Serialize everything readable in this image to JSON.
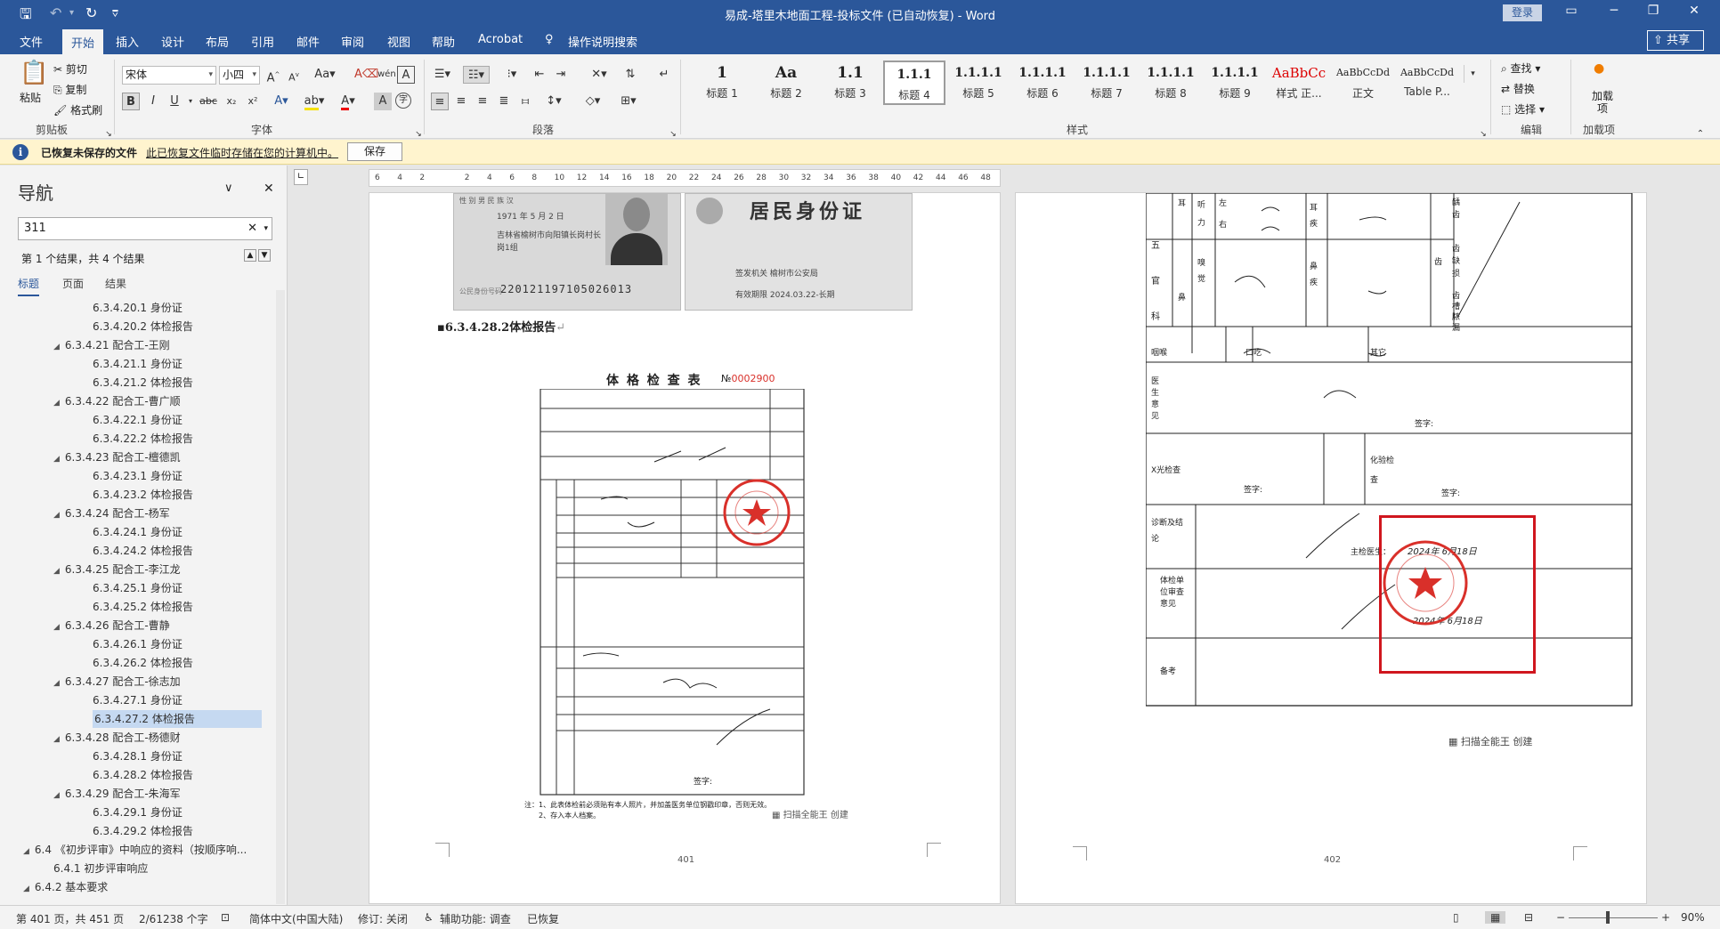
{
  "window": {
    "title": "易成-塔里木地面工程-投标文件 (已自动恢复)  -  Word",
    "login": "登录"
  },
  "tabs": [
    "文件",
    "开始",
    "插入",
    "设计",
    "布局",
    "引用",
    "邮件",
    "审阅",
    "视图",
    "帮助",
    "Acrobat",
    "操作说明搜索"
  ],
  "share": "共享",
  "ribbon": {
    "clipboard": {
      "paste": "粘贴",
      "cut": "剪切",
      "copy": "复制",
      "format_painter": "格式刷",
      "group": "剪贴板"
    },
    "font": {
      "name": "宋体",
      "size": "小四",
      "group": "字体"
    },
    "paragraph": {
      "group": "段落"
    },
    "styles": {
      "group": "样式",
      "items": [
        {
          "sample": "1",
          "name": "标题 1"
        },
        {
          "sample": "Aa",
          "name": "标题 2"
        },
        {
          "sample": "1.1",
          "name": "标题 3"
        },
        {
          "sample": "1.1.1",
          "name": "标题 4"
        },
        {
          "sample": "1.1.1.1",
          "name": "标题 5"
        },
        {
          "sample": "1.1.1.1",
          "name": "标题 6"
        },
        {
          "sample": "1.1.1.1",
          "name": "标题 7"
        },
        {
          "sample": "1.1.1.1",
          "name": "标题 8"
        },
        {
          "sample": "1.1.1.1",
          "name": "标题 9"
        },
        {
          "sample": "AaBbCc",
          "name": "样式 正..."
        },
        {
          "sample": "AaBbCcDd",
          "name": "正文"
        },
        {
          "sample": "AaBbCcDd",
          "name": "Table P..."
        }
      ]
    },
    "editing": {
      "find": "查找",
      "replace": "替换",
      "select": "选择",
      "group": "编辑"
    },
    "addins": {
      "label": "加载项",
      "group": "加载项"
    }
  },
  "infobar": {
    "title": "已恢复未保存的文件",
    "message": "此已恢复文件临时存储在您的计算机中。",
    "save": "保存"
  },
  "nav": {
    "title": "导航",
    "search": "311",
    "result_count": "第 1 个结果，共 4 个结果",
    "tabs": [
      "标题",
      "页面",
      "结果"
    ],
    "items": [
      {
        "text": "6.3.4.20.1 身份证",
        "level": 3
      },
      {
        "text": "6.3.4.20.2 体检报告",
        "level": 3
      },
      {
        "text": "6.3.4.21 配合工-王刚",
        "level": 2
      },
      {
        "text": "6.3.4.21.1 身份证",
        "level": 3
      },
      {
        "text": "6.3.4.21.2 体检报告",
        "level": 3
      },
      {
        "text": "6.3.4.22 配合工-曹广顺",
        "level": 2
      },
      {
        "text": "6.3.4.22.1 身份证",
        "level": 3
      },
      {
        "text": "6.3.4.22.2 体检报告",
        "level": 3
      },
      {
        "text": "6.3.4.23 配合工-檀德凯",
        "level": 2
      },
      {
        "text": "6.3.4.23.1 身份证",
        "level": 3
      },
      {
        "text": "6.3.4.23.2 体检报告",
        "level": 3
      },
      {
        "text": "6.3.4.24 配合工-杨军",
        "level": 2
      },
      {
        "text": "6.3.4.24.1 身份证",
        "level": 3
      },
      {
        "text": "6.3.4.24.2 体检报告",
        "level": 3
      },
      {
        "text": "6.3.4.25 配合工-李江龙",
        "level": 2
      },
      {
        "text": "6.3.4.25.1 身份证",
        "level": 3
      },
      {
        "text": "6.3.4.25.2 体检报告",
        "level": 3
      },
      {
        "text": "6.3.4.26 配合工-曹静",
        "level": 2
      },
      {
        "text": "6.3.4.26.1 身份证",
        "level": 3
      },
      {
        "text": "6.3.4.26.2 体检报告",
        "level": 3
      },
      {
        "text": "6.3.4.27 配合工-徐志加",
        "level": 2
      },
      {
        "text": "6.3.4.27.1 身份证",
        "level": 3
      },
      {
        "text": "6.3.4.27.2 体检报告",
        "level": 3,
        "selected": true
      },
      {
        "text": "6.3.4.28 配合工-杨德财",
        "level": 2
      },
      {
        "text": "6.3.4.28.1 身份证",
        "level": 3
      },
      {
        "text": "6.3.4.28.2 体检报告",
        "level": 3
      },
      {
        "text": "6.3.4.29 配合工-朱海军",
        "level": 2
      },
      {
        "text": "6.3.4.29.1 身份证",
        "level": 3
      },
      {
        "text": "6.3.4.29.2 体检报告",
        "level": 3
      },
      {
        "text": "6.4 《初步评审》中响应的资料（按顺序响...",
        "level": 0
      },
      {
        "text": "6.4.1 初步评审响应",
        "level": 1
      },
      {
        "text": "6.4.2 基本要求",
        "level": 0
      }
    ]
  },
  "ruler": [
    "6",
    "4",
    "2",
    "",
    "2",
    "4",
    "6",
    "8",
    "10",
    "12",
    "14",
    "16",
    "18",
    "20",
    "22",
    "24",
    "26",
    "28",
    "30",
    "32",
    "34",
    "36",
    "38",
    "40",
    "42",
    "44",
    "46",
    "48"
  ],
  "page_left": {
    "id_card": {
      "gender_label": "性 别",
      "gender": "男",
      "ethnic_label": "民 族",
      "ethnic": "汉",
      "birth": "1971 年 5 月 2 日",
      "address": "吉林省榆树市向阳镇长岗村长岗1组",
      "id_label": "公民身份号码",
      "id_number": "220121197105026013",
      "back_title": "居民身份证",
      "issuer_label": "签发机关",
      "issuer": "榆树市公安局",
      "validity_label": "有效期限",
      "validity": "2024.03.22-长期"
    },
    "heading": "6.3.4.28.2体检报告",
    "form": {
      "title": "体 格 检 查 表",
      "number_prefix": "№",
      "number": "0002900",
      "footnote_1": "注：1、此表体检前必须贴有本人照片，并加盖医务单位钢戳印章，否则无效。",
      "footnote_2": "2、存入本人档案。",
      "sign_label": "签字:"
    },
    "scanner_credit": "扫描全能王 创建",
    "page_number": "401"
  },
  "page_right": {
    "labels": {
      "ear": "耳",
      "hearing": "听力",
      "left": "左",
      "right": "右",
      "ear_disease": "耳疾",
      "five_senses": "五官科",
      "smell": "嗅觉",
      "nose": "鼻",
      "nose_disease": "鼻疾",
      "teeth": "齿",
      "caries": "龋齿",
      "missing_teeth": "齿缺损",
      "periodontal": "齿槽脓漏",
      "throat": "咽喉",
      "stutter": "口吃",
      "other": "其它",
      "doctor_opinion": "医生意见",
      "sign": "签字:",
      "xray": "X光检查",
      "lab": "化验检查",
      "diagnosis": "诊断及结论",
      "chief_doctor": "主检医生：",
      "unit_opinion": "体检单位审查意见",
      "remarks": "备考"
    },
    "date_1": "2024年 6月18日",
    "date_2": "2024年 6月18日",
    "scanner_credit": "扫描全能王 创建",
    "page_number": "402"
  },
  "status": {
    "page": "第 401 页，共 451 页",
    "words": "2/61238 个字",
    "language": "简体中文(中国大陆)",
    "track": "修订: 关闭",
    "accessibility": "辅助功能: 调查",
    "recovered": "已恢复",
    "zoom": "90%"
  },
  "colors": {
    "accent": "#2b579a",
    "stamp": "#d9302a",
    "highlight_box": "#d0161e"
  }
}
